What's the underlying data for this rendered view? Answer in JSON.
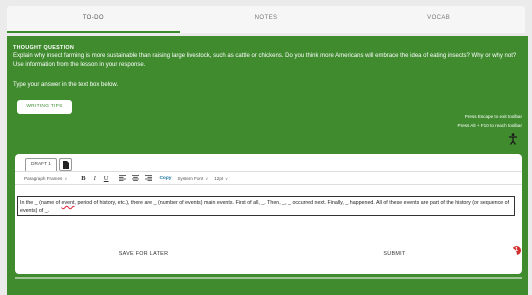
{
  "tabs": [
    {
      "label": "TO-DO",
      "active": true
    },
    {
      "label": "NOTES",
      "active": false
    },
    {
      "label": "VOCAB",
      "active": false
    }
  ],
  "question": {
    "title": "THOUGHT QUESTION",
    "body": "Explain why insect farming is more sustainable than raising large livestock, such as cattle or chickens. Do you think more Americans will embrace the idea of eating insects? Why or why not? Use information from the lesson in your response.",
    "instruction": "Type your answer in the text box below.",
    "tips_label": "WRITING TIPS"
  },
  "hints": {
    "escape": "Press Escape to exit toolbar",
    "altf10": "Press Alt + F10 to reach toolbar"
  },
  "editor": {
    "draft_label": "DRAFT 1",
    "toolbar": {
      "paragraph": "Paragraph Frames",
      "bold": "B",
      "italic": "I",
      "underline": "U",
      "copy": "Copy",
      "font": "System Font",
      "size": "12pt"
    },
    "text_before": "In the _ (name of ",
    "text_misspelled": "event",
    "text_after": ", period of history, etc.), there are _ (number of events) main events. First of all, _. Then, _, _ occurred next. Finally, _ happened. All of these events are part of the history (or sequence of events) of _.",
    "badge_count": "1"
  },
  "actions": {
    "save": "SAVE FOR LATER",
    "submit": "SUBMIT"
  },
  "colors": {
    "panel_green": "#3f8b2e",
    "badge_red": "#d32f2f",
    "link_blue": "#1a73a8"
  }
}
